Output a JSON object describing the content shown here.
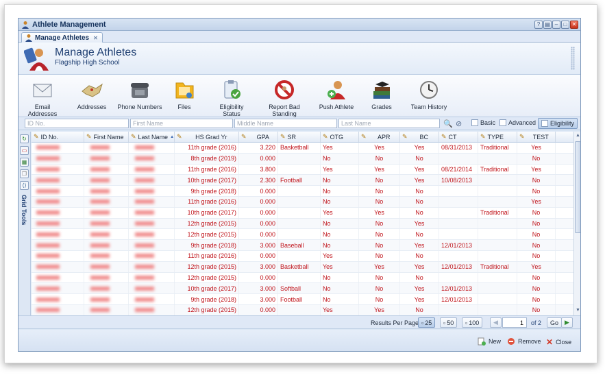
{
  "window": {
    "title": "Athlete Management",
    "controls": [
      "help-icon",
      "restore-icon",
      "minimize-icon",
      "maximize-icon",
      "close-icon"
    ]
  },
  "tab": {
    "label": "Manage Athletes"
  },
  "header": {
    "title": "Manage Athletes",
    "subtitle": "Flagship High School"
  },
  "toolbar": [
    {
      "label": "Email Addresses",
      "icon": "envelope-icon"
    },
    {
      "label": "Addresses",
      "icon": "map-icon"
    },
    {
      "label": "Phone Numbers",
      "icon": "phone-icon"
    },
    {
      "label": "Files",
      "icon": "folder-icon"
    },
    {
      "label": "Eligibility Status",
      "icon": "clipboard-check-icon"
    },
    {
      "label": "Report Bad Standing",
      "icon": "no-entry-icon"
    },
    {
      "label": "Push Athlete",
      "icon": "person-add-icon"
    },
    {
      "label": "Grades",
      "icon": "book-stack-icon"
    },
    {
      "label": "Team History",
      "icon": "clock-icon"
    }
  ],
  "filters": {
    "id_placeholder": "ID No.",
    "first_placeholder": "First Name",
    "middle_placeholder": "Middle Name",
    "last_placeholder": "Last Name",
    "views": [
      "Basic",
      "Advanced",
      "Eligibility"
    ],
    "active_view": "Eligibility"
  },
  "sidebar": {
    "label": "Grid Tools"
  },
  "columns": [
    "ID No.",
    "First Name",
    "Last Name",
    "HS Grad Yr",
    "GPA",
    "SR",
    "OTG",
    "APR",
    "BC",
    "CT",
    "TYPE",
    "TEST"
  ],
  "rows": [
    [
      "11th grade (2016)",
      "3.220",
      "Basketball",
      "Yes",
      "Yes",
      "Yes",
      "08/31/2013",
      "Traditional",
      "Yes"
    ],
    [
      "8th grade (2019)",
      "0.000",
      "",
      "No",
      "No",
      "No",
      "",
      "",
      "No"
    ],
    [
      "11th grade (2016)",
      "3.800",
      "",
      "Yes",
      "Yes",
      "Yes",
      "08/21/2014",
      "Traditional",
      "Yes"
    ],
    [
      "10th grade (2017)",
      "2.300",
      "Football",
      "No",
      "No",
      "Yes",
      "10/08/2013",
      "",
      "No"
    ],
    [
      "9th grade (2018)",
      "0.000",
      "",
      "No",
      "No",
      "No",
      "",
      "",
      "No"
    ],
    [
      "11th grade (2016)",
      "0.000",
      "",
      "No",
      "No",
      "No",
      "",
      "",
      "Yes"
    ],
    [
      "10th grade (2017)",
      "0.000",
      "",
      "Yes",
      "Yes",
      "No",
      "",
      "Traditional",
      "No"
    ],
    [
      "12th grade (2015)",
      "0.000",
      "",
      "No",
      "No",
      "Yes",
      "",
      "",
      "No"
    ],
    [
      "12th grade (2015)",
      "0.000",
      "",
      "No",
      "No",
      "No",
      "",
      "",
      "No"
    ],
    [
      "9th grade (2018)",
      "3.000",
      "Baseball",
      "No",
      "No",
      "Yes",
      "12/01/2013",
      "",
      "No"
    ],
    [
      "11th grade (2016)",
      "0.000",
      "",
      "Yes",
      "No",
      "No",
      "",
      "",
      "No"
    ],
    [
      "12th grade (2015)",
      "3.000",
      "Basketball",
      "Yes",
      "Yes",
      "Yes",
      "12/01/2013",
      "Traditional",
      "Yes"
    ],
    [
      "12th grade (2015)",
      "0.000",
      "",
      "No",
      "No",
      "No",
      "",
      "",
      "No"
    ],
    [
      "10th grade (2017)",
      "3.000",
      "Softball",
      "No",
      "No",
      "Yes",
      "12/01/2013",
      "",
      "No"
    ],
    [
      "9th grade (2018)",
      "3.000",
      "Football",
      "No",
      "No",
      "Yes",
      "12/01/2013",
      "",
      "No"
    ],
    [
      "12th grade (2015)",
      "0.000",
      "",
      "Yes",
      "Yes",
      "No",
      "",
      "",
      "No"
    ]
  ],
  "pager": {
    "results_label": "Results Per Page:",
    "sizes": [
      "25",
      "50",
      "100"
    ],
    "page": "1",
    "of_label": "of 2",
    "go_label": "Go"
  },
  "footer": {
    "new_label": "New",
    "remove_label": "Remove",
    "close_label": "Close"
  },
  "colors": {
    "cell_text": "#c0131a",
    "accent": "#1f3f72"
  }
}
